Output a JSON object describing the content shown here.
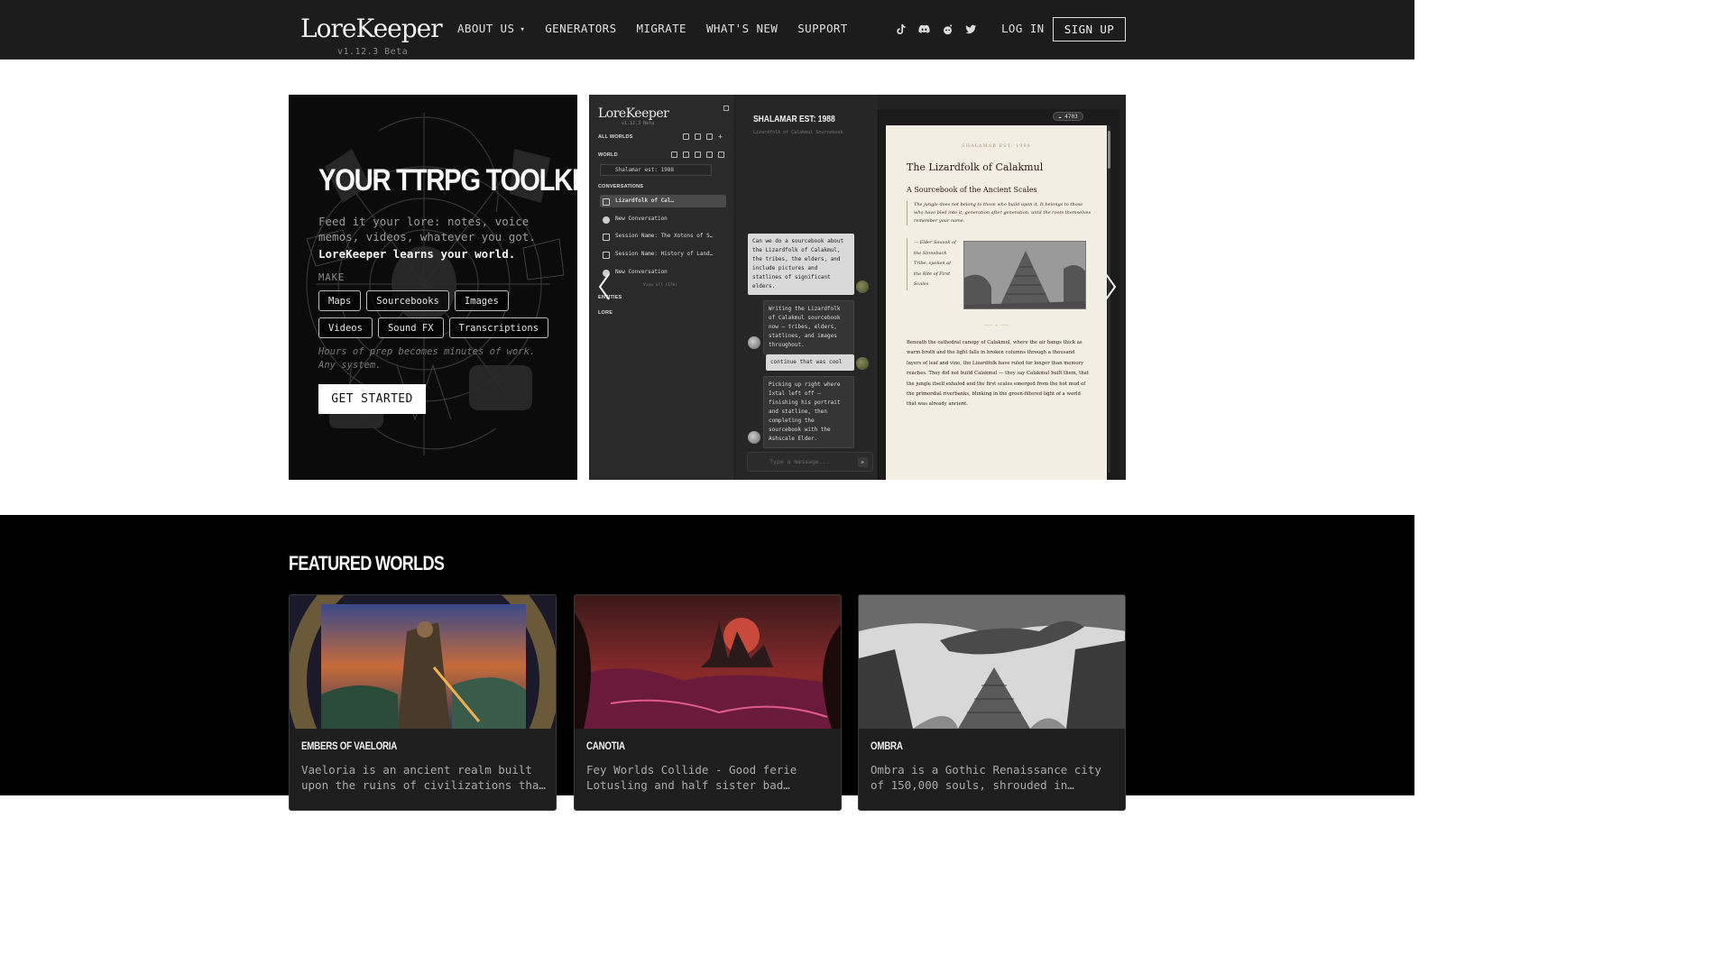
{
  "nav": {
    "logo": "LoreKeeper",
    "version": "v1.12.3 Beta",
    "links": [
      "ABOUT US",
      "GENERATORS",
      "MIGRATE",
      "WHAT'S NEW",
      "SUPPORT"
    ],
    "socials": [
      "tiktok-icon",
      "discord-icon",
      "reddit-icon",
      "twitter-icon"
    ],
    "login": "LOG IN",
    "signup": "SIGN UP"
  },
  "hero": {
    "title": "YOUR TTRPG TOOLKIT",
    "lead": "Feed it your lore: notes, voice memos, videos, whatever you got.",
    "strong": "LoreKeeper learns your world.",
    "make_label": "MAKE",
    "chips": [
      "Maps",
      "Sourcebooks",
      "Images",
      "Videos",
      "Sound FX",
      "Transcriptions"
    ],
    "note": "Hours of prep becomes minutes of work. Any system.",
    "cta": "GET STARTED"
  },
  "preview": {
    "logo": "LoreKeeper",
    "version": "v1.12.3 Beta",
    "all_worlds": "ALL WORLDS",
    "world_label": "WORLD",
    "world_select": "Shalamar est: 1988",
    "conversations_label": "CONVERSATIONS",
    "conversations": [
      "Lizardfolk of Cal…",
      "New Conversation",
      "Session Name: The Xotons of S…",
      "Session Name: History of Land…",
      "New Conversation"
    ],
    "view_all": "View all (170)",
    "entities_label": "ENTITIES",
    "lore_label": "LORE",
    "chat_title": "SHALAMAR EST: 1988",
    "chat_subtitle": "Lizardfolk of Calakmul Sourcebook",
    "messages": [
      "Can we do a sourcebook about the Lizardfolk of Calakmul, the tribes, the elders, and include pictures and statlines of significant elders.",
      "Writing the Lizardfolk of Calakmul sourcebook now — tribes, elders, statlines, and images throughout.",
      "continue that was cool",
      "Picking up right where Ixtal left off — finishing his portrait and statline, then completing the sourcebook with the Ashscale Elder."
    ],
    "input_placeholder": "Type a message...",
    "badge": "4703",
    "doc": {
      "kicker": "SHALAMAR EST: 1988",
      "title": "The Lizardfolk of Calakmul",
      "subtitle": "A Sourcebook of the Ancient Scales",
      "quote": "The jungle does not belong to those who build upon it. It belongs to those who have bled into it, generation after generation, until the roots themselves remember your name.",
      "caption": "— Elder Sauvak of the Stoneback Tribe, spoken at the Rite of First Scales",
      "divider": "——— ✦ ———",
      "body": "Beneath the cathedral canopy of Calakmul, where the air hangs thick as warm broth and the light falls in broken columns through a thousand layers of leaf and vine, the Lizardfolk have ruled for longer than memory reaches. They did not build Calakmul — they say Calakmul built them, that the jungle itself exhaled and the first scales emerged from the hot mud of the primordial riverbanks, blinking in the green-filtered light of a world that was already ancient."
    }
  },
  "featured": {
    "title": "FEATURED WORLDS",
    "cards": [
      {
        "name": "EMBERS OF VAELORIA",
        "desc": "Vaeloria is an ancient realm built upon the ruins of civilizations tha…"
      },
      {
        "name": "CANOTIA",
        "desc": "Fey Worlds Collide - Good ferie Lotusling and half sister bad…"
      },
      {
        "name": "OMBRA",
        "desc": "Ombra is a Gothic Renaissance city of 150,000 souls, shrouded in…"
      }
    ]
  },
  "colors": {
    "nav_bg": "#1c1c1c",
    "featured_bg": "#000000",
    "doc_paper": "#f3eee4"
  }
}
